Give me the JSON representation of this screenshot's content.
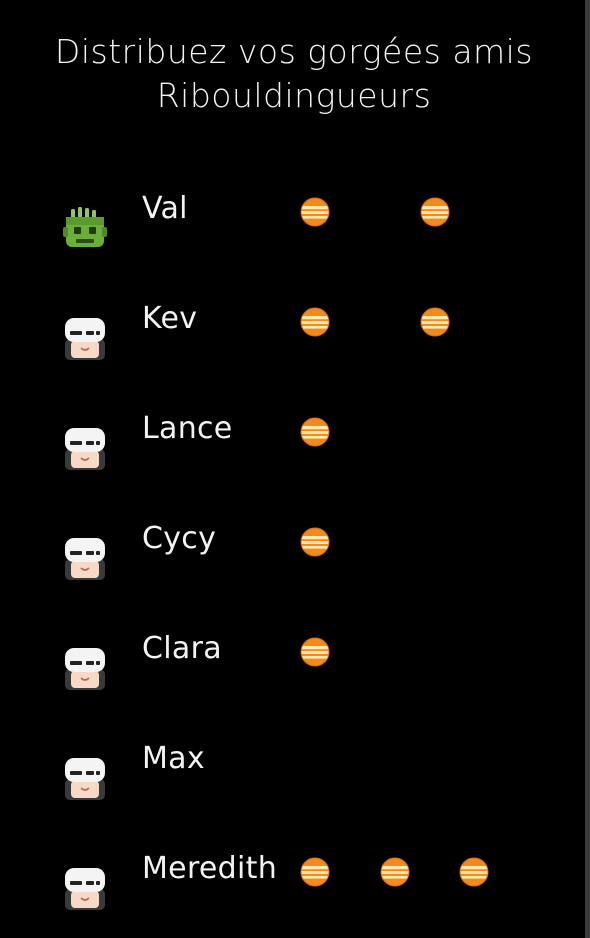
{
  "title_line1": "Distribuez vos gorgées amis",
  "title_line2": "Ribouldingueurs",
  "colors": {
    "background": "#000000",
    "text": "#f3f3f3",
    "sip_orange": "#f28a1c",
    "sip_cream": "#ffe9b0",
    "zombie_green": "#6cae3a",
    "mask_white": "#f4f4f4"
  },
  "icons": {
    "sip": "beer-ball-icon",
    "zombie": "zombie-avatar-icon",
    "masked": "masked-avatar-icon"
  },
  "players": [
    {
      "name": "Val",
      "avatar": "zombie",
      "sips": 2
    },
    {
      "name": "Kev",
      "avatar": "masked",
      "sips": 2
    },
    {
      "name": "Lance",
      "avatar": "masked",
      "sips": 1
    },
    {
      "name": "Cycy",
      "avatar": "masked",
      "sips": 1
    },
    {
      "name": "Clara",
      "avatar": "masked",
      "sips": 1
    },
    {
      "name": "Max",
      "avatar": "masked",
      "sips": 0
    },
    {
      "name": "Meredith",
      "avatar": "masked",
      "sips": 3
    }
  ]
}
